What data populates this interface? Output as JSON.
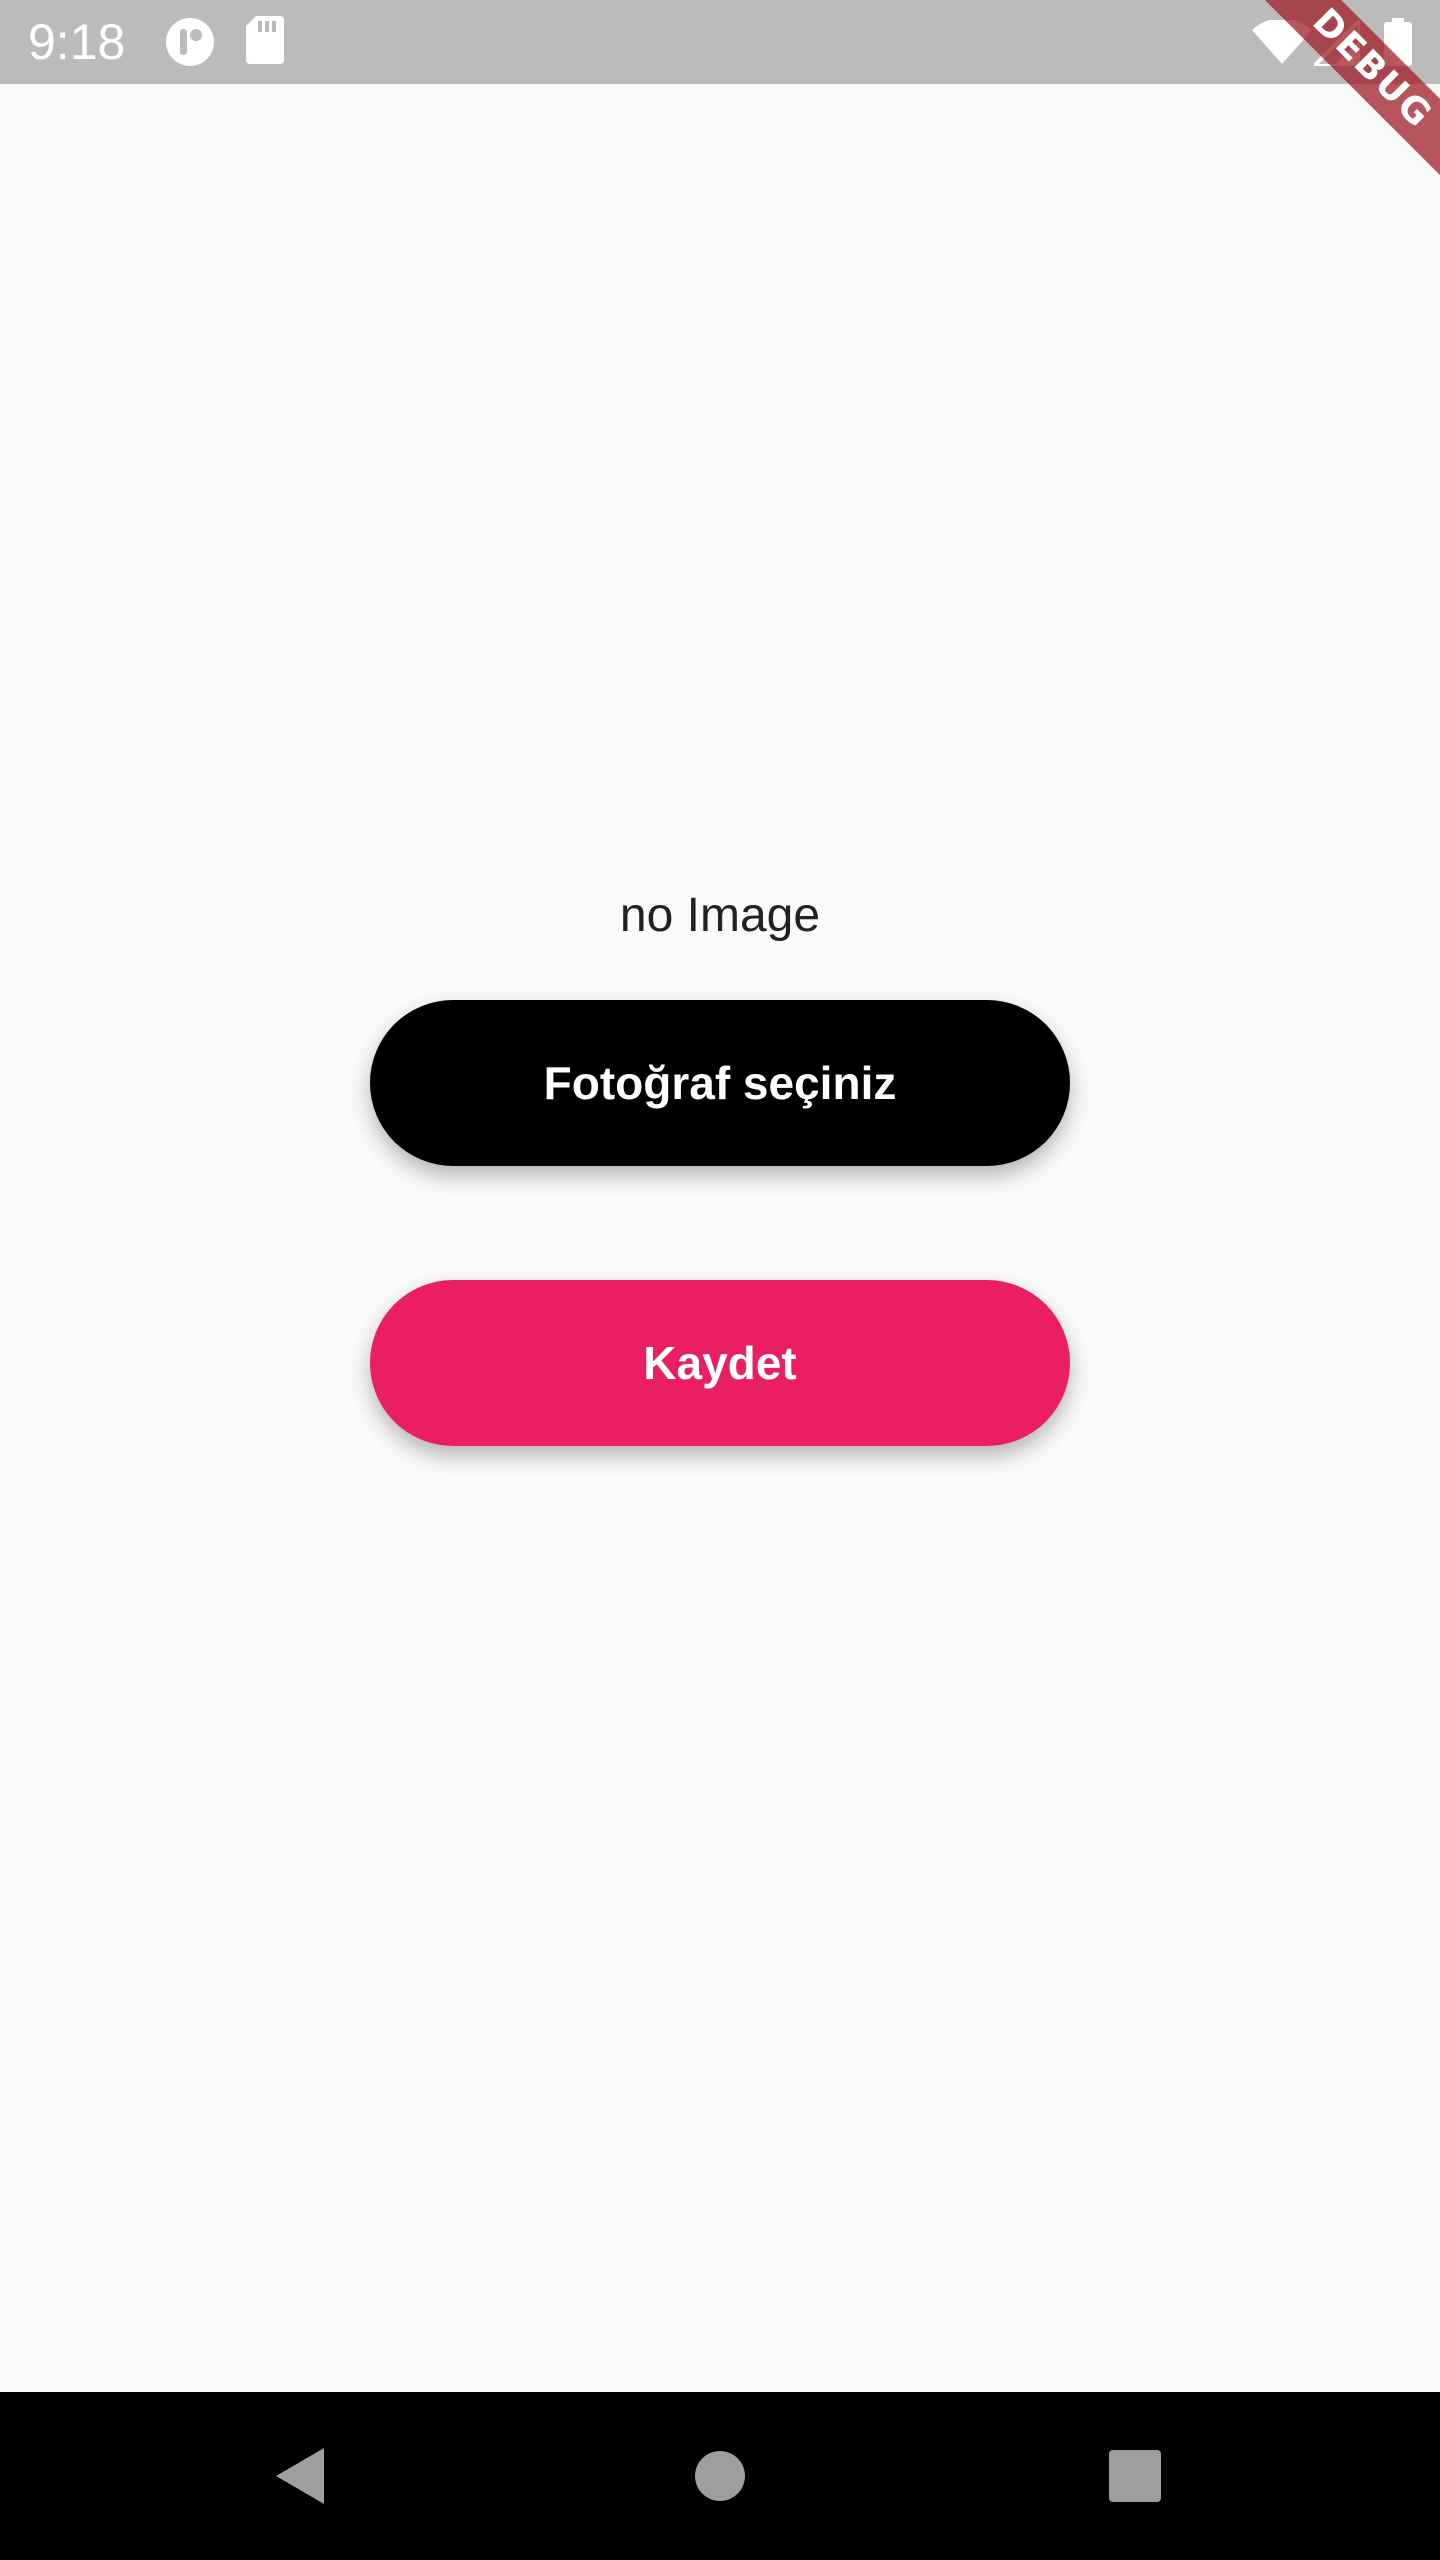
{
  "status_bar": {
    "time": "9:18",
    "icons": [
      "app-notification-icon",
      "sd-card-icon",
      "wifi-icon",
      "cell-signal-icon",
      "battery-icon"
    ]
  },
  "debug_banner": {
    "label": "DEBUG"
  },
  "main": {
    "image_placeholder_text": "no Image",
    "select_photo_button": "Fotoğraf seçiniz",
    "save_button": "Kaydet"
  },
  "colors": {
    "status_bar": "#bbbbbb",
    "background": "#fafafa",
    "select_button": "#000000",
    "save_button": "#e91e63",
    "nav_bar": "#000000",
    "nav_icons": "#9e9e9e"
  },
  "nav_bar": {
    "icons": [
      "back-icon",
      "home-icon",
      "recents-icon"
    ]
  }
}
